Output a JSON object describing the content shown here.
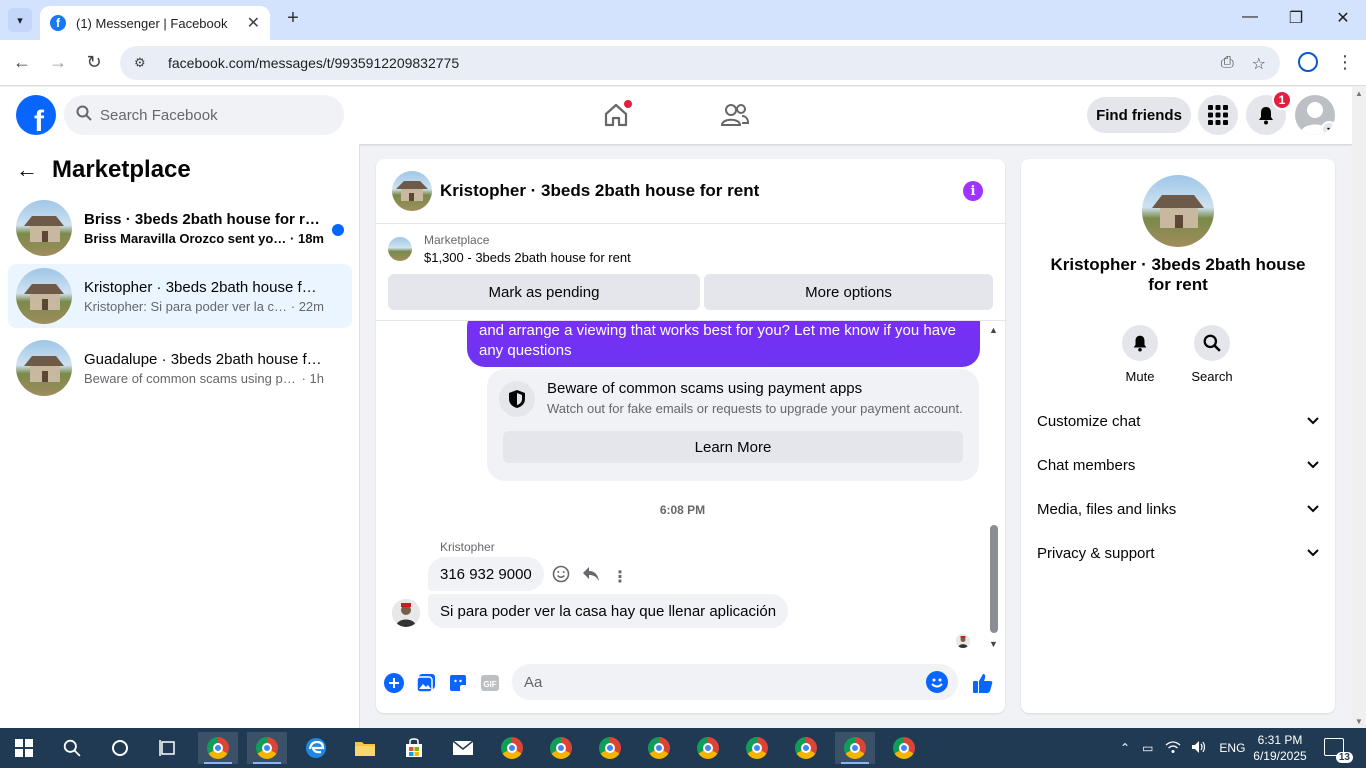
{
  "browser": {
    "tab_title": "(1) Messenger | Facebook",
    "url": "facebook.com/messages/t/9935912209832775"
  },
  "fb_header": {
    "search_placeholder": "Search Facebook",
    "find_friends_label": "Find friends",
    "notification_count": "1"
  },
  "sidebar": {
    "title": "Marketplace",
    "conversations": [
      {
        "name": "Briss · 3beds 2bath house for rent",
        "snippet": "Briss Maravilla Orozco sent you a...",
        "time": "· 18m",
        "unread": true
      },
      {
        "name": "Kristopher · 3beds 2bath house for...",
        "snippet": "Kristopher: Si para poder ver la casa...",
        "time": "· 22m",
        "unread": false
      },
      {
        "name": "Guadalupe · 3beds 2bath house fo...",
        "snippet": "Beware of common scams using pay...",
        "time": "· 1h",
        "unread": false
      }
    ]
  },
  "chat": {
    "title": "Kristopher · 3beds 2bath house for rent",
    "marketplace_label": "Marketplace",
    "listing": "$1,300 - 3beds 2bath house for rent",
    "mark_pending_label": "Mark as pending",
    "more_options_label": "More options",
    "outgoing_message": "and arrange a viewing that works best for you? Let me know if you have any questions",
    "scam_title": "Beware of common scams using payment apps",
    "scam_desc": "Watch out for fake emails or requests to upgrade your payment account.",
    "learn_more_label": "Learn More",
    "timestamp": "6:08 PM",
    "sender_name": "Kristopher",
    "messages_in": [
      "316 932 9000",
      "Si para poder ver la casa hay que llenar aplicación"
    ],
    "composer_placeholder": "Aa"
  },
  "info_panel": {
    "name": "Kristopher · 3beds 2bath house for rent",
    "mute_label": "Mute",
    "search_label": "Search",
    "sections": [
      "Customize chat",
      "Chat members",
      "Media, files and links",
      "Privacy & support"
    ]
  },
  "taskbar": {
    "lang": "ENG",
    "time": "6:31 PM",
    "date": "6/19/2025",
    "notifications": "13"
  },
  "colors": {
    "accent": "#0866ff",
    "outgoing_bubble": "#7b2ff7",
    "info_icon": "#a033ff",
    "badge": "#e41e3f"
  }
}
